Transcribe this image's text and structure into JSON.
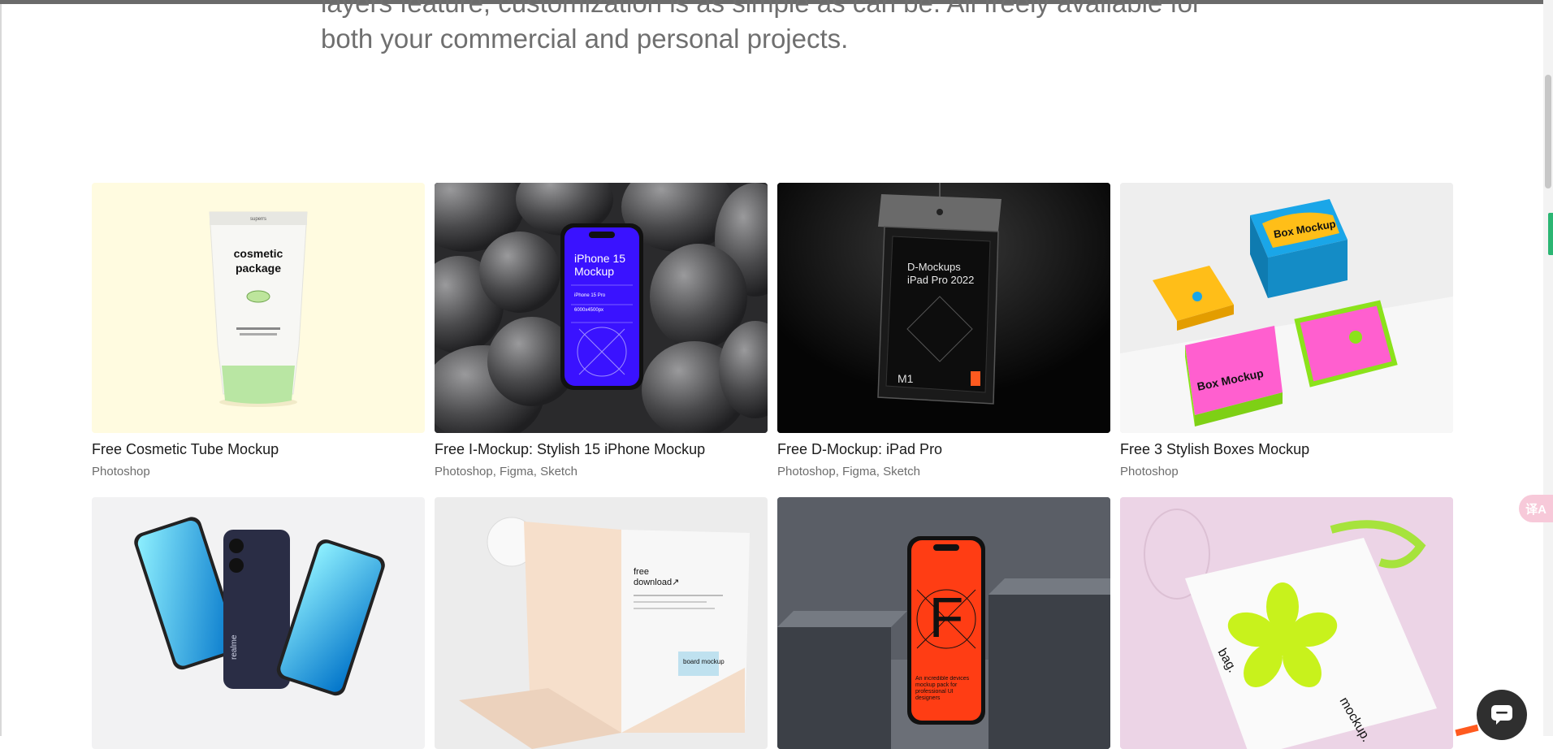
{
  "intro": {
    "text": "layers feature, customization is as simple as can be. All freely available for both your commercial and personal projects."
  },
  "cards": [
    {
      "title": "Free Cosmetic Tube Mockup",
      "tools": "Photoshop",
      "art": {
        "brand": "superrs",
        "line1": "cosmetic",
        "line2": "package"
      }
    },
    {
      "title": "Free I-Mockup: Stylish 15 iPhone Mockup",
      "tools": "Photoshop, Figma, Sketch",
      "art": {
        "line1": "iPhone 15",
        "line2": "Mockup",
        "sub": "iPhone 15 Pro",
        "size": "6000x4500px"
      }
    },
    {
      "title": "Free D-Mockup: iPad Pro",
      "tools": "Photoshop, Figma, Sketch",
      "art": {
        "line1": "D-Mockups",
        "line2": "iPad Pro 2022",
        "code": "M1"
      }
    },
    {
      "title": "Free 3 Stylish Boxes Mockup",
      "tools": "Photoshop",
      "art": {
        "label": "Box Mockup"
      }
    },
    {
      "title": "",
      "tools": "",
      "art": {
        "brand": "realme"
      }
    },
    {
      "title": "",
      "tools": "",
      "art": {
        "line1": "free",
        "line2": "download↗",
        "note": "board mockup"
      }
    },
    {
      "title": "",
      "tools": "",
      "art": {
        "letter": "F",
        "caption": "An incredible devices mockup pack for professional UI designers"
      }
    },
    {
      "title": "",
      "tools": "",
      "art": {
        "left": "bag.",
        "right": "mockup."
      }
    }
  ],
  "widgets": {
    "translate_label": "译A",
    "chat_icon": "chat-bubble-icon"
  },
  "colors": {
    "cosmetic_bg": "#fffbe0",
    "tube_cap": "#b9e6a3",
    "iphone_screen": "#3a12ff",
    "box_blue": "#1aa6e8",
    "box_yellow": "#ffbe18",
    "box_pink": "#ff5fcf",
    "box_green": "#8be21b",
    "phone_orange": "#ff3d14",
    "bag_green": "#c8f21c"
  }
}
